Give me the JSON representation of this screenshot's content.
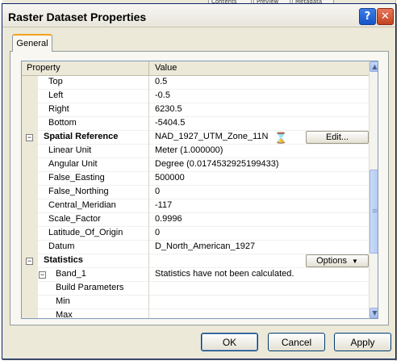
{
  "background": {
    "tabs": [
      "Contents",
      "Preview",
      "Metadata"
    ]
  },
  "dialog": {
    "title": "Raster Dataset Properties",
    "help_symbol": "?",
    "close_symbol": "✕",
    "tab_label": "General",
    "grid": {
      "header_property": "Property",
      "header_value": "Value",
      "rows": [
        {
          "kind": "sub",
          "property": "Top",
          "value": "0.5"
        },
        {
          "kind": "sub",
          "property": "Left",
          "value": "-0.5"
        },
        {
          "kind": "sub",
          "property": "Right",
          "value": "6230.5"
        },
        {
          "kind": "sub",
          "property": "Bottom",
          "value": "-5404.5"
        },
        {
          "kind": "cat",
          "property": "Spatial Reference",
          "value": "NAD_1927_UTM_Zone_11N",
          "button": "Edit..."
        },
        {
          "kind": "sub",
          "property": "Linear Unit",
          "value": "Meter (1.000000)"
        },
        {
          "kind": "sub",
          "property": "Angular Unit",
          "value": "Degree (0.0174532925199433)"
        },
        {
          "kind": "sub",
          "property": "False_Easting",
          "value": "500000"
        },
        {
          "kind": "sub",
          "property": "False_Northing",
          "value": "0"
        },
        {
          "kind": "sub",
          "property": "Central_Meridian",
          "value": "-117"
        },
        {
          "kind": "sub",
          "property": "Scale_Factor",
          "value": "0.9996"
        },
        {
          "kind": "sub",
          "property": "Latitude_Of_Origin",
          "value": "0"
        },
        {
          "kind": "sub",
          "property": "Datum",
          "value": "D_North_American_1927"
        },
        {
          "kind": "cat",
          "property": "Statistics",
          "value": "",
          "button": "Options"
        },
        {
          "kind": "band",
          "property": "Band_1",
          "value": "Statistics have not been calculated."
        },
        {
          "kind": "deep",
          "property": "Build Parameters",
          "value": ""
        },
        {
          "kind": "deep",
          "property": "Min",
          "value": ""
        },
        {
          "kind": "deep",
          "property": "Max",
          "value": ""
        }
      ]
    },
    "buttons": {
      "ok": "OK",
      "cancel": "Cancel",
      "apply": "Apply"
    }
  },
  "colors": {
    "titlebar": "#ece9d8",
    "dialog_face": "#ece9d8",
    "grid_border": "#7f9db9"
  }
}
